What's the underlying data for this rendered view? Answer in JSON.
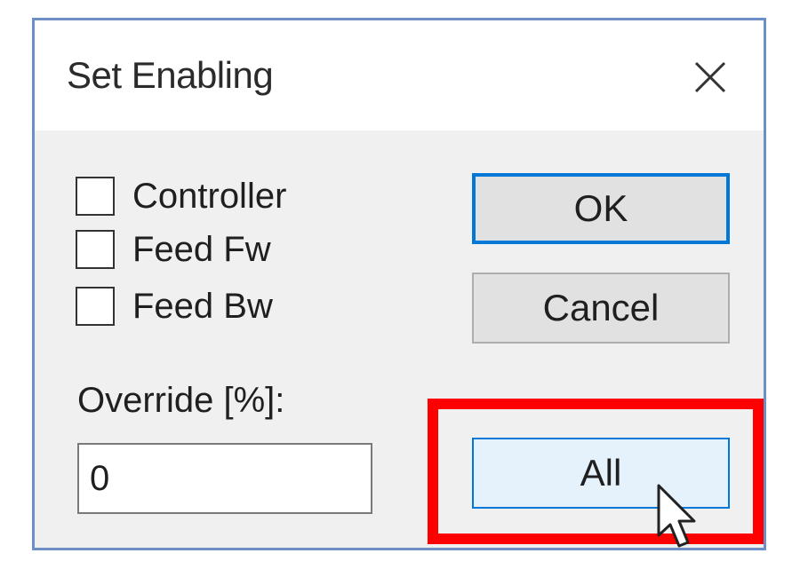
{
  "dialog": {
    "title": "Set Enabling",
    "close_icon": "close-icon"
  },
  "checkboxes": [
    {
      "label": "Controller",
      "checked": false
    },
    {
      "label": "Feed Fw",
      "checked": false
    },
    {
      "label": "Feed Bw",
      "checked": false
    }
  ],
  "override": {
    "label": "Override [%]:",
    "value": "0"
  },
  "buttons": {
    "ok": "OK",
    "cancel": "Cancel",
    "all": "All"
  },
  "annotation": {
    "highlight_color": "#ff0000",
    "highlighted": "All"
  },
  "colors": {
    "accent": "#0078d7",
    "button_face": "#e1e1e1",
    "button_hover": "#e5f1fb"
  },
  "pointer": "arrow-cursor-icon"
}
